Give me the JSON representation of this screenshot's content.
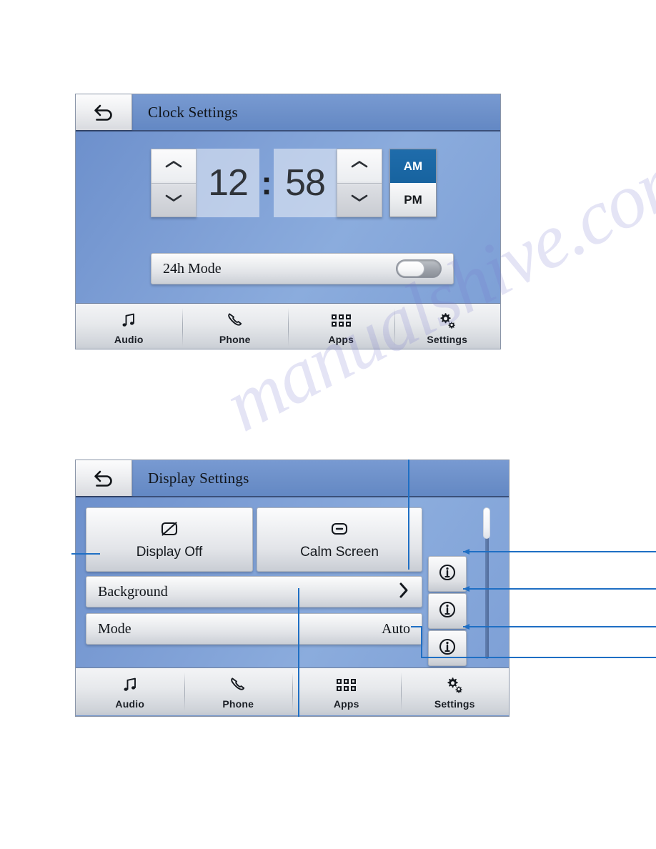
{
  "page": {
    "watermark": "manualshive.com"
  },
  "clock_screen": {
    "back_icon": "back-arrow-icon",
    "title": "Clock Settings",
    "hours": "12",
    "separator": ":",
    "minutes": "58",
    "hour_up": "chevron-up-icon",
    "hour_down": "chevron-down-icon",
    "minute_up": "chevron-up-icon",
    "minute_down": "chevron-down-icon",
    "am_label": "AM",
    "pm_label": "PM",
    "am_selected": true,
    "mode_row": {
      "label": "24h Mode",
      "toggle_state": "off"
    },
    "nav": [
      {
        "label": "Audio",
        "icon": "music-note-icon"
      },
      {
        "label": "Phone",
        "icon": "phone-handset-icon"
      },
      {
        "label": "Apps",
        "icon": "apps-grid-icon"
      },
      {
        "label": "Settings",
        "icon": "gears-icon"
      }
    ]
  },
  "display_screen": {
    "back_icon": "back-arrow-icon",
    "title": "Display Settings",
    "tiles": [
      {
        "label": "Display Off",
        "icon": "display-off-icon"
      },
      {
        "label": "Calm Screen",
        "icon": "calm-screen-icon"
      }
    ],
    "rows": [
      {
        "label": "Background",
        "value": "",
        "accessory": "chevron-right-icon"
      },
      {
        "label": "Mode",
        "value": "Auto",
        "accessory": ""
      }
    ],
    "info_buttons": [
      {
        "icon": "info-icon"
      },
      {
        "icon": "info-icon"
      },
      {
        "icon": "info-icon"
      }
    ],
    "scrollbar": {
      "position": "top"
    },
    "nav": [
      {
        "label": "Audio",
        "icon": "music-note-icon"
      },
      {
        "label": "Phone",
        "icon": "phone-handset-icon"
      },
      {
        "label": "Apps",
        "icon": "apps-grid-icon"
      },
      {
        "label": "Settings",
        "icon": "gears-icon"
      }
    ]
  },
  "colors": {
    "accent_blue": "#1f6cab",
    "screen_blue": "#7fa0d6",
    "callout_blue": "#1f6fc4",
    "nav_bg": "#e7e9ec"
  }
}
